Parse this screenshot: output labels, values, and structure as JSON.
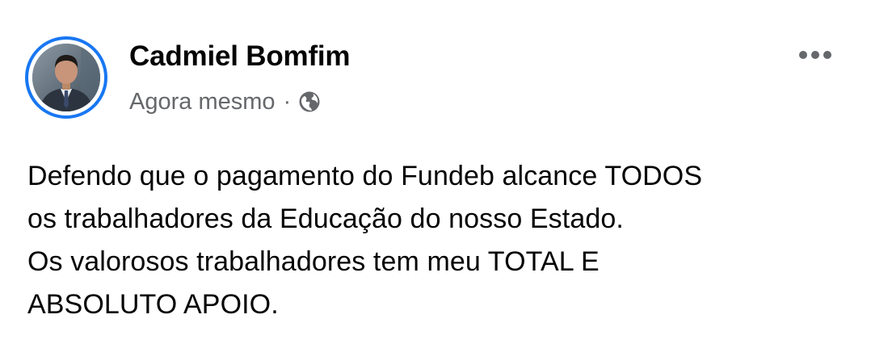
{
  "post": {
    "author": "Cadmiel Bomfim",
    "timestamp": "Agora mesmo",
    "separator": "·",
    "audience_icon": "globe-icon",
    "more_icon": "more-options-icon",
    "text_lines": [
      "Defendo que o pagamento do Fundeb alcance TODOS",
      "os trabalhadores da Educação do nosso Estado.",
      "Os valorosos trabalhadores tem meu TOTAL E",
      "ABSOLUTO APOIO."
    ]
  },
  "colors": {
    "avatar_ring": "#1877f2",
    "secondary_text": "#65676b",
    "primary_text": "#050505",
    "background": "#ffffff"
  }
}
